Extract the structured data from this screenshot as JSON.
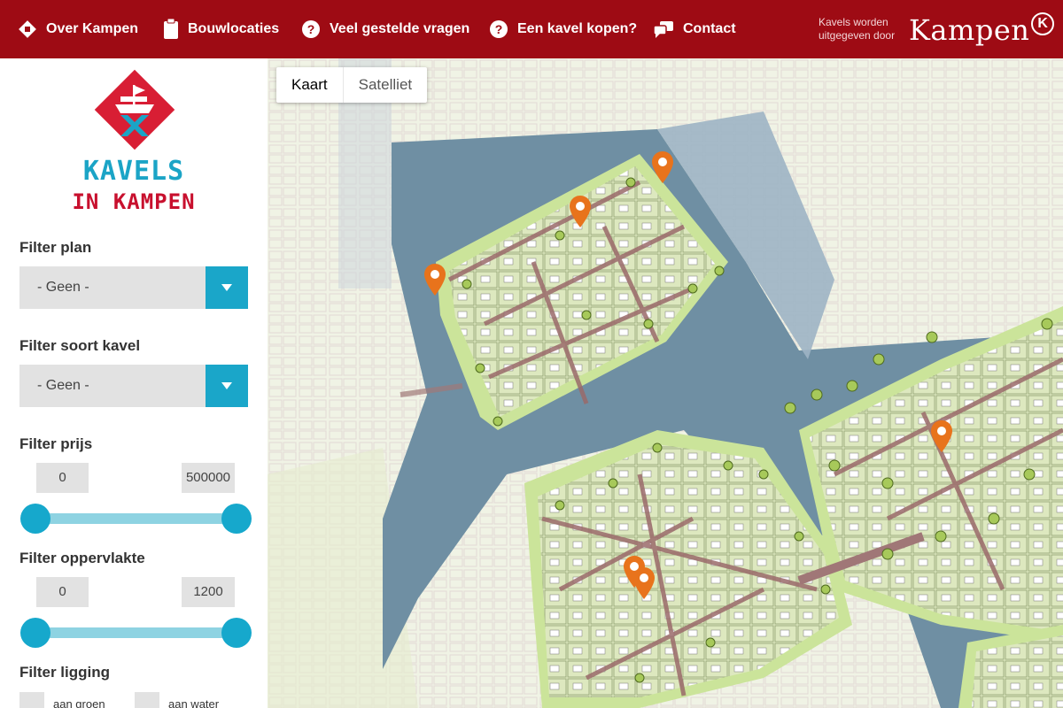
{
  "nav": {
    "items": [
      {
        "label": "Over Kampen",
        "icon": "diamond-emblem-icon"
      },
      {
        "label": "Bouwlocaties",
        "icon": "clipboard-icon"
      },
      {
        "label": "Veel gestelde vragen",
        "icon": "question-circle-icon"
      },
      {
        "label": "Een kavel kopen?",
        "icon": "question-circle-icon"
      },
      {
        "label": "Contact",
        "icon": "chat-bubbles-icon"
      }
    ],
    "brand_caption_line1": "Kavels worden",
    "brand_caption_line2": "uitgegeven door",
    "brand_name": "Kampen",
    "brand_mark": "K"
  },
  "sidebar": {
    "logo_line1": "KAVELS",
    "logo_line2": "IN KAMPEN",
    "filter_plan": {
      "title": "Filter plan",
      "value": "- Geen -"
    },
    "filter_soort": {
      "title": "Filter soort kavel",
      "value": "- Geen -"
    },
    "filter_prijs": {
      "title": "Filter prijs",
      "min": "0",
      "max": "500000"
    },
    "filter_oppervlakte": {
      "title": "Filter oppervlakte",
      "min": "0",
      "max": "1200"
    },
    "filter_ligging": {
      "title": "Filter ligging",
      "options": [
        "aan groen",
        "aan water"
      ]
    }
  },
  "map": {
    "toggle": {
      "map_label": "Kaart",
      "satellite_label": "Satelliet",
      "active": "Kaart"
    }
  },
  "colors": {
    "header_red": "#9e0b14",
    "accent_blue": "#1aa6c9",
    "logo_red": "#c8102e",
    "pin_orange": "#e8731c",
    "water": "#6f8fa3",
    "lot_green": "#dbe8bd"
  }
}
